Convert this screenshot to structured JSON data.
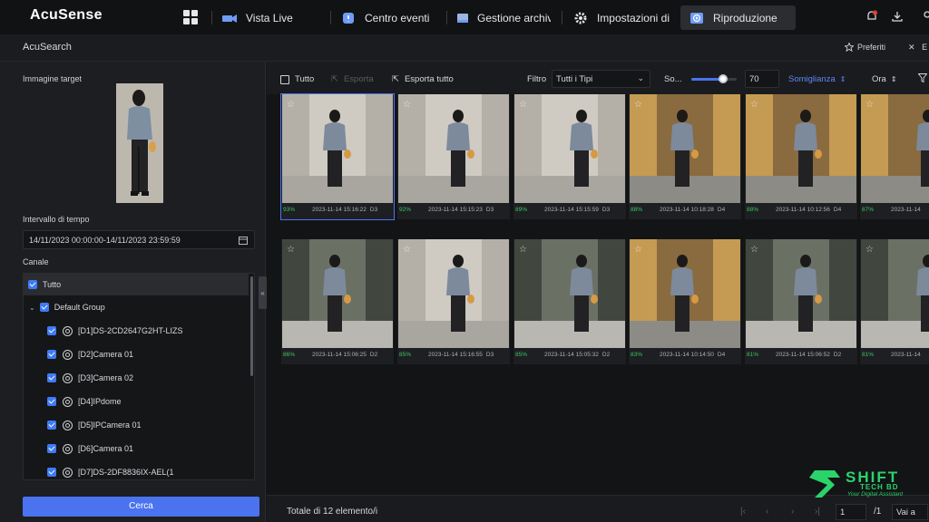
{
  "app": {
    "logo": "AcuSense"
  },
  "tabs": [
    {
      "label": "Vista Live",
      "icon": "camera-icon",
      "active": false
    },
    {
      "label": "Centro eventi",
      "icon": "event-center-icon",
      "active": false
    },
    {
      "label": "Gestione archivi",
      "icon": "archive-icon",
      "active": false
    },
    {
      "label": "Impostazioni di",
      "icon": "gear-icon",
      "active": false
    },
    {
      "label": "Riproduzione",
      "icon": "playback-icon",
      "active": true
    }
  ],
  "subheader": {
    "title": "AcuSearch",
    "favorites": "Preferiti",
    "exit": "E"
  },
  "left": {
    "target_label": "Immagine target",
    "time_label": "Intervallo di tempo",
    "time_value": "14/11/2023 00:00:00-14/11/2023 23:59:59",
    "channel_label": "Canale",
    "channels": [
      {
        "label": "Tutto",
        "level": 0
      },
      {
        "label": "Default Group",
        "level": 1
      },
      {
        "label": "[D1]DS-2CD2647G2HT-LIZS",
        "level": 2
      },
      {
        "label": "[D2]Camera 01",
        "level": 2
      },
      {
        "label": "[D3]Camera 02",
        "level": 2
      },
      {
        "label": "[D4]IPdome",
        "level": 2
      },
      {
        "label": "[D5]IPCamera 01",
        "level": 2
      },
      {
        "label": "[D6]Camera 01",
        "level": 2
      },
      {
        "label": "[D7]DS-2DF8836IX-AEL(1",
        "level": 2
      }
    ],
    "search_button": "Cerca"
  },
  "toolbar": {
    "select_all": "Tutto",
    "export": "Esporta",
    "export_all": "Esporta tutto",
    "filter_label": "Filtro",
    "filter_value": "Tutti i Tipi",
    "threshold_label": "So...",
    "threshold_value": "70",
    "threshold_fraction": 0.7,
    "sort_similarity": "Somiglianza",
    "sort_time": "Ora"
  },
  "results": [
    {
      "pct": "93%",
      "time": "2023-11-14 15:16:22",
      "ch": "D3",
      "scene": "corridor",
      "selected": true
    },
    {
      "pct": "92%",
      "time": "2023-11-14 15:15:23",
      "ch": "D3",
      "scene": "corridor",
      "selected": false
    },
    {
      "pct": "89%",
      "time": "2023-11-14 15:15:59",
      "ch": "D3",
      "scene": "corridor",
      "selected": false
    },
    {
      "pct": "88%",
      "time": "2023-11-14 10:18:28",
      "ch": "D4",
      "scene": "shop",
      "selected": false
    },
    {
      "pct": "88%",
      "time": "2023-11-14 10:12:56",
      "ch": "D4",
      "scene": "shop",
      "selected": false
    },
    {
      "pct": "87%",
      "time": "2023-11-14",
      "ch": "",
      "scene": "shop",
      "selected": false
    },
    {
      "pct": "86%",
      "time": "2023-11-14 15:06:25",
      "ch": "D2",
      "scene": "entrance",
      "selected": false
    },
    {
      "pct": "85%",
      "time": "2023-11-14 15:16:55",
      "ch": "D3",
      "scene": "corridor",
      "selected": false
    },
    {
      "pct": "85%",
      "time": "2023-11-14 15:05:32",
      "ch": "D2",
      "scene": "entrance",
      "selected": false
    },
    {
      "pct": "83%",
      "time": "2023-11-14 10:14:50",
      "ch": "D4",
      "scene": "shop",
      "selected": false
    },
    {
      "pct": "81%",
      "time": "2023-11-14 15:06:52",
      "ch": "D2",
      "scene": "entrance",
      "selected": false
    },
    {
      "pct": "81%",
      "time": "2023-11-14",
      "ch": "",
      "scene": "entrance",
      "selected": false
    }
  ],
  "footer": {
    "total": "Totale di 12 elemento/i",
    "page_value": "1",
    "page_total": "/1",
    "goto": "Vai a"
  },
  "watermark": {
    "brand": "SHIFT",
    "sub": "TECH BD",
    "tagline": "Your Digital Assistant"
  },
  "colors": {
    "accent": "#4b73f0",
    "similarity": "#38c763",
    "watermark": "#2bd36b"
  }
}
